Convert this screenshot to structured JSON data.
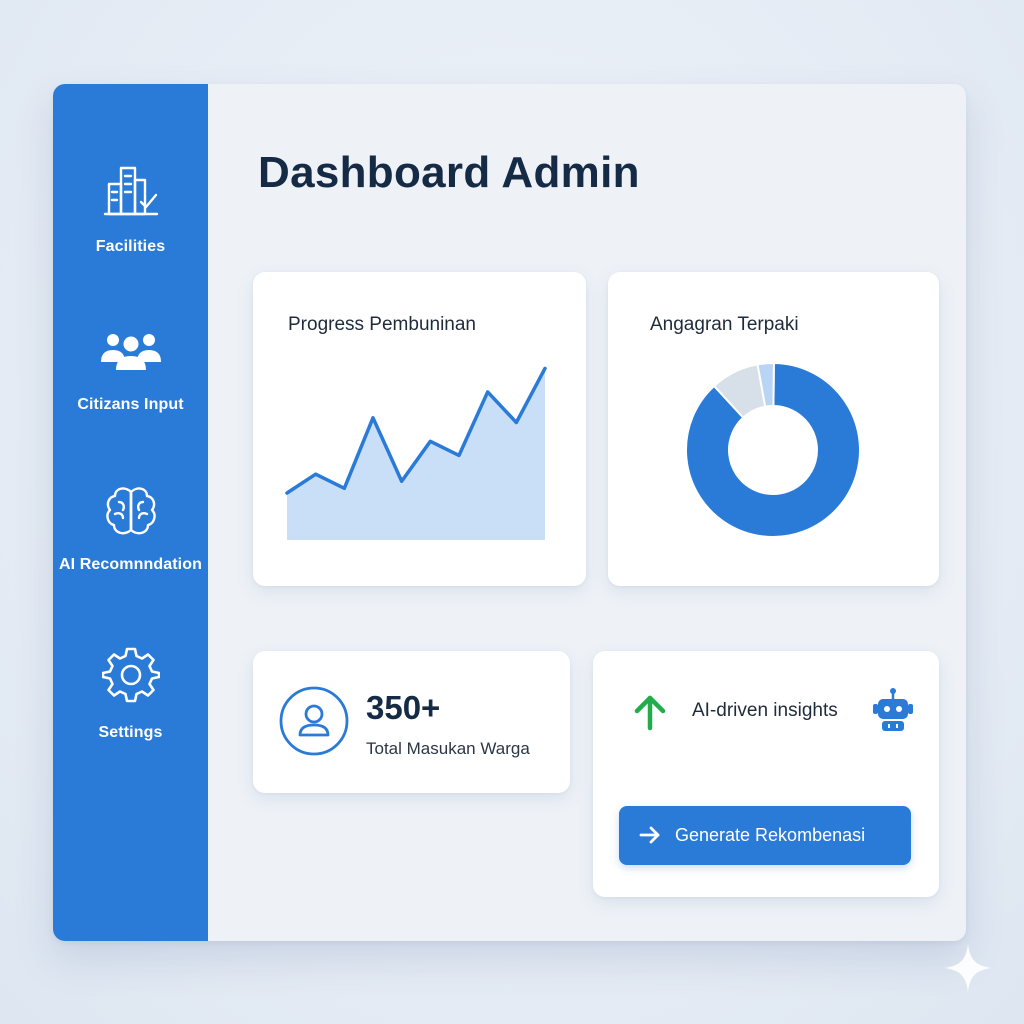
{
  "sidebar": {
    "items": [
      {
        "label": "Facilities",
        "icon": "building-check-icon"
      },
      {
        "label": "Citizans Input",
        "icon": "users-icon"
      },
      {
        "label": "AI Recomnndation",
        "icon": "brain-icon"
      },
      {
        "label": "Settings",
        "icon": "gear-icon"
      }
    ]
  },
  "main": {
    "title": "Dashboard Admin",
    "progress_card": {
      "title": "Progress Pembuninan"
    },
    "budget_card": {
      "title": "Angagran Terpaki"
    },
    "stat_card": {
      "value": "350+",
      "label": "Total Masukan Warga",
      "icon": "user-icon"
    },
    "ai_card": {
      "text": "AI-driven insights",
      "arrow_icon": "arrow-up-icon",
      "robot_icon": "robot-icon",
      "button_label": "Generate Rekombenasi",
      "button_icon": "arrow-right-icon"
    }
  },
  "colors": {
    "primary": "#2a7ad8",
    "area_fill": "#c9dff7",
    "donut_light": "#d7dfe8",
    "donut_pale": "#b9d5f5",
    "up_arrow": "#1fae4b",
    "title": "#142a45"
  },
  "chart_data": [
    {
      "type": "area",
      "title": "Progress Pembuninan",
      "x": [
        1,
        2,
        3,
        4,
        5,
        6,
        7,
        8,
        9,
        10,
        11
      ],
      "values": [
        20,
        28,
        22,
        52,
        25,
        42,
        36,
        63,
        50,
        73
      ],
      "ylim": [
        0,
        80
      ],
      "grid": false,
      "legend": "none"
    },
    {
      "type": "pie",
      "title": "Angagran Terpaki",
      "donut": true,
      "values": [
        88,
        9,
        3
      ],
      "colors": [
        "#2a7ad8",
        "#d7dfe8",
        "#b9d5f5"
      ],
      "legend": "none"
    }
  ]
}
